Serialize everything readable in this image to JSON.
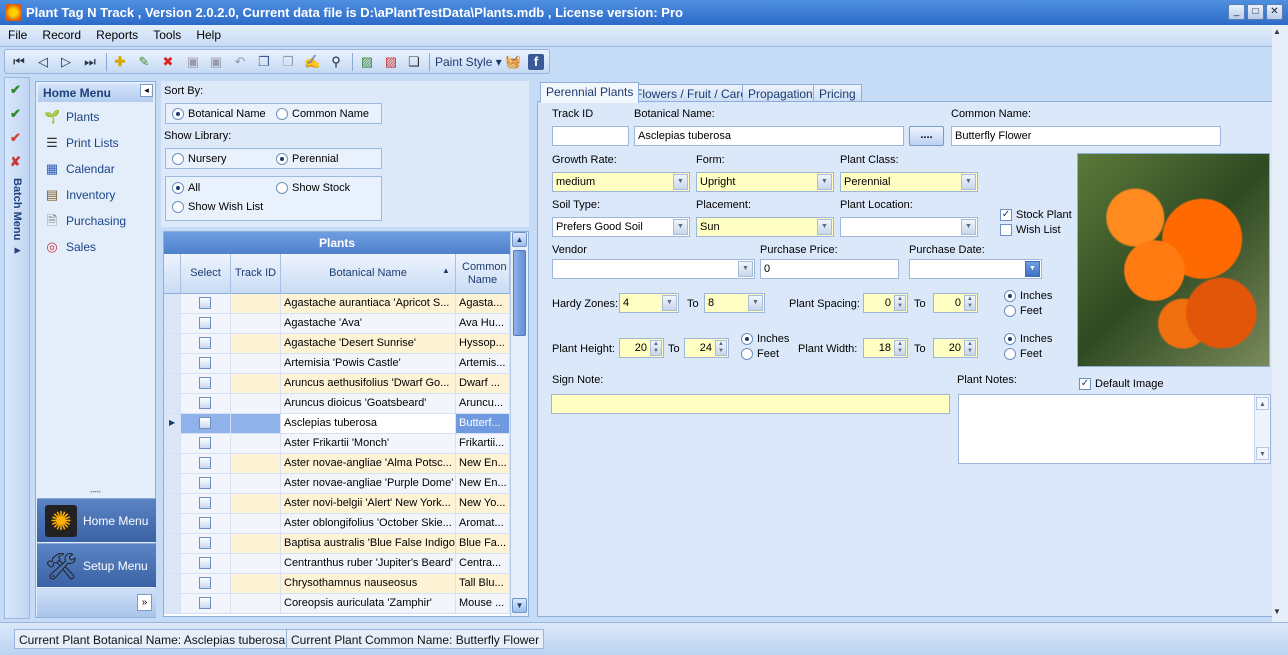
{
  "window": {
    "title": "Plant Tag N Track , Version 2.0.2.0, Current data file is D:\\aPlantTestData\\Plants.mdb , License version: Pro",
    "minimize": "_",
    "maximize": "□",
    "close": "✕"
  },
  "menu": [
    "File",
    "Record",
    "Reports",
    "Tools",
    "Help"
  ],
  "toolbar": {
    "paint_style_label": "Paint Style",
    "icons": [
      "first-icon",
      "prev-icon",
      "next-icon",
      "last-icon",
      "add-icon",
      "edit-icon",
      "delete-icon",
      "save-icon",
      "save-all-icon",
      "undo-icon",
      "copy-icon",
      "paste-icon",
      "note-icon",
      "find-icon",
      "image-icon",
      "remove-image-icon",
      "window-icon",
      "basket-icon",
      "facebook-icon"
    ]
  },
  "batch_menu": {
    "label": "Batch Menu"
  },
  "home_menu": {
    "header": "Home Menu",
    "items": [
      {
        "label": "Plants",
        "icon": "plant-icon"
      },
      {
        "label": "Print Lists",
        "icon": "list-icon"
      },
      {
        "label": "Calendar",
        "icon": "calendar-icon"
      },
      {
        "label": "Inventory",
        "icon": "inventory-icon"
      },
      {
        "label": "Purchasing",
        "icon": "purchasing-icon"
      },
      {
        "label": "Sales",
        "icon": "sales-icon"
      }
    ],
    "home_button": "Home Menu",
    "setup_button": "Setup Menu"
  },
  "sort": {
    "sort_by_label": "Sort By:",
    "botanical": "Botanical Name",
    "common": "Common Name",
    "sort_selected": "botanical",
    "library_label": "Show Library:",
    "nursery": "Nursery",
    "perennial": "Perennial",
    "library_selected": "perennial",
    "all": "All",
    "show_stock": "Show Stock",
    "show_wish": "Show Wish List",
    "filter_selected": "all"
  },
  "grid": {
    "title": "Plants",
    "columns": [
      "Select",
      "Track ID",
      "Botanical Name",
      "Common Name"
    ],
    "selected_index": 6,
    "rows": [
      {
        "botanical": "Agastache aurantiaca 'Apricot S...",
        "common": "Agasta..."
      },
      {
        "botanical": "Agastache 'Ava'",
        "common": "Ava Hu..."
      },
      {
        "botanical": "Agastache 'Desert Sunrise'",
        "common": "Hyssop..."
      },
      {
        "botanical": "Artemisia 'Powis Castle'",
        "common": "Artemis..."
      },
      {
        "botanical": "Aruncus aethusifolius 'Dwarf Go...",
        "common": "Dwarf ..."
      },
      {
        "botanical": "Aruncus dioicus 'Goatsbeard'",
        "common": "Aruncu..."
      },
      {
        "botanical": "Asclepias tuberosa",
        "common": "Butterf..."
      },
      {
        "botanical": "Aster Frikartii 'Monch'",
        "common": "Frikartii..."
      },
      {
        "botanical": "Aster novae-angliae 'Alma Potsc...",
        "common": "New En..."
      },
      {
        "botanical": "Aster novae-angliae 'Purple Dome'",
        "common": "New En..."
      },
      {
        "botanical": "Aster novi-belgii 'Alert' New York...",
        "common": "New Yo..."
      },
      {
        "botanical": "Aster oblongifolius 'October Skie...",
        "common": "Aromat..."
      },
      {
        "botanical": "Baptisa australis 'Blue False Indigo'",
        "common": "Blue Fa..."
      },
      {
        "botanical": "Centranthus ruber 'Jupiter's Beard'",
        "common": "Centra..."
      },
      {
        "botanical": "Chrysothamnus nauseosus",
        "common": "Tall Blu..."
      },
      {
        "botanical": "Coreopsis auriculata 'Zamphir'",
        "common": "Mouse ..."
      }
    ]
  },
  "tabs": [
    "Perennial Plants",
    "Flowers / Fruit / Care",
    "Propagation",
    "Pricing"
  ],
  "form": {
    "track_id_label": "Track ID",
    "track_id": "",
    "botanical_label": "Botanical Name:",
    "botanical": "Asclepias tuberosa",
    "browse_button": "....",
    "common_label": "Common Name:",
    "common": "Butterfly Flower",
    "growth_rate_label": "Growth Rate:",
    "growth_rate": "medium",
    "form_label": "Form:",
    "form": "Upright",
    "plant_class_label": "Plant Class:",
    "plant_class": "Perennial",
    "soil_type_label": "Soil Type:",
    "soil_type": "Prefers Good Soil",
    "placement_label": "Placement:",
    "placement": "Sun",
    "plant_location_label": "Plant Location:",
    "plant_location": "",
    "stock_plant_label": "Stock Plant",
    "stock_plant": true,
    "wish_list_label": "Wish List",
    "wish_list": false,
    "vendor_label": "Vendor",
    "vendor": "",
    "purchase_price_label": "Purchase Price:",
    "purchase_price": "0",
    "purchase_date_label": "Purchase Date:",
    "purchase_date": "",
    "hardy_zones_label": "Hardy Zones:",
    "hardy_from": "4",
    "to_label": "To",
    "hardy_to": "8",
    "plant_spacing_label": "Plant Spacing:",
    "spacing_from": "0",
    "spacing_to": "0",
    "inches_label": "Inches",
    "feet_label": "Feet",
    "plant_height_label": "Plant Height:",
    "height_from": "20",
    "height_to": "24",
    "plant_width_label": "Plant Width:",
    "width_from": "18",
    "width_to": "20",
    "sign_note_label": "Sign Note:",
    "sign_note": "",
    "plant_notes_label": "Plant Notes:",
    "plant_notes": "",
    "default_image_label": "Default Image",
    "default_image": true
  },
  "status": {
    "botanical": "Current Plant Botanical Name: Asclepias tuberosa",
    "common": "Current Plant Common Name: Butterfly Flower"
  }
}
